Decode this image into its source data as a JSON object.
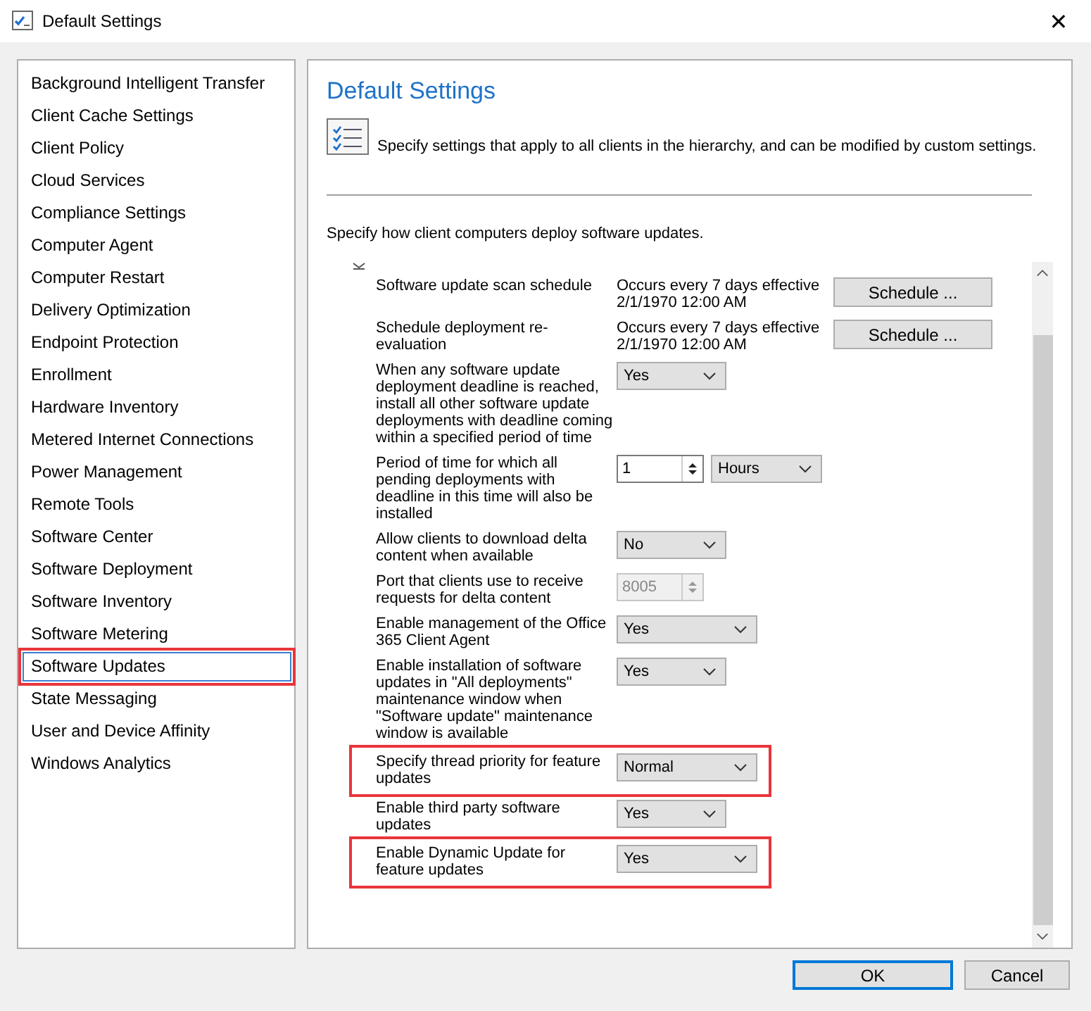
{
  "window": {
    "title": "Default Settings",
    "close": "✕"
  },
  "sidebar": {
    "items": [
      {
        "label": "Background Intelligent Transfer",
        "selected": false,
        "highlighted": false
      },
      {
        "label": "Client Cache Settings",
        "selected": false,
        "highlighted": false
      },
      {
        "label": "Client Policy",
        "selected": false,
        "highlighted": false
      },
      {
        "label": "Cloud Services",
        "selected": false,
        "highlighted": false
      },
      {
        "label": "Compliance Settings",
        "selected": false,
        "highlighted": false
      },
      {
        "label": "Computer Agent",
        "selected": false,
        "highlighted": false
      },
      {
        "label": "Computer Restart",
        "selected": false,
        "highlighted": false
      },
      {
        "label": "Delivery Optimization",
        "selected": false,
        "highlighted": false
      },
      {
        "label": "Endpoint Protection",
        "selected": false,
        "highlighted": false
      },
      {
        "label": "Enrollment",
        "selected": false,
        "highlighted": false
      },
      {
        "label": "Hardware Inventory",
        "selected": false,
        "highlighted": false
      },
      {
        "label": "Metered Internet Connections",
        "selected": false,
        "highlighted": false
      },
      {
        "label": "Power Management",
        "selected": false,
        "highlighted": false
      },
      {
        "label": "Remote Tools",
        "selected": false,
        "highlighted": false
      },
      {
        "label": "Software Center",
        "selected": false,
        "highlighted": false
      },
      {
        "label": "Software Deployment",
        "selected": false,
        "highlighted": false
      },
      {
        "label": "Software Inventory",
        "selected": false,
        "highlighted": false
      },
      {
        "label": "Software Metering",
        "selected": false,
        "highlighted": false
      },
      {
        "label": "Software Updates",
        "selected": true,
        "highlighted": true
      },
      {
        "label": "State Messaging",
        "selected": false,
        "highlighted": false
      },
      {
        "label": "User and Device Affinity",
        "selected": false,
        "highlighted": false
      },
      {
        "label": "Windows Analytics",
        "selected": false,
        "highlighted": false
      }
    ]
  },
  "panel": {
    "title": "Default Settings",
    "description": "Specify settings that apply to all clients in the hierarchy, and can be modified by custom settings.",
    "intro": "Specify how client computers deploy software updates.",
    "settings": [
      {
        "kind": "schedule",
        "label": "Software update scan schedule",
        "value": "Occurs every 7 days effective 2/1/1970 12:00 AM",
        "button": "Schedule ...",
        "highlighted": false
      },
      {
        "kind": "schedule",
        "label": "Schedule deployment re-evaluation",
        "value": "Occurs every 7 days effective 2/1/1970 12:00 AM",
        "button": "Schedule ...",
        "highlighted": false
      },
      {
        "kind": "select",
        "label": "When any software update deployment deadline is reached, install all other software update deployments with deadline coming within a specified period of time",
        "value": "Yes",
        "wide": false,
        "highlighted": false
      },
      {
        "kind": "spin-select",
        "label": "Period of time for which all pending deployments with deadline in this time will also be installed",
        "value": "1",
        "unit": "Hours",
        "highlighted": false
      },
      {
        "kind": "select",
        "label": "Allow clients to download delta content when available",
        "value": "No",
        "wide": false,
        "highlighted": false
      },
      {
        "kind": "spin",
        "label": "Port that clients use to receive requests for delta content",
        "value": "8005",
        "disabled": true,
        "highlighted": false
      },
      {
        "kind": "select",
        "label": "Enable management of the Office 365 Client Agent",
        "value": "Yes",
        "wide": true,
        "highlighted": false
      },
      {
        "kind": "select",
        "label": "Enable installation of software updates in \"All deployments\" maintenance window when \"Software update\" maintenance window is available",
        "value": "Yes",
        "wide": false,
        "highlighted": false
      },
      {
        "kind": "select",
        "label": "Specify thread priority for feature updates",
        "value": "Normal",
        "wide": true,
        "highlighted": true
      },
      {
        "kind": "select",
        "label": "Enable third party software updates",
        "value": "Yes",
        "wide": false,
        "highlighted": false
      },
      {
        "kind": "select",
        "label": "Enable Dynamic Update for feature updates",
        "value": "Yes",
        "wide": true,
        "highlighted": true
      }
    ]
  },
  "buttons": [
    {
      "label": "OK",
      "default": true
    },
    {
      "label": "Cancel",
      "default": false
    }
  ]
}
